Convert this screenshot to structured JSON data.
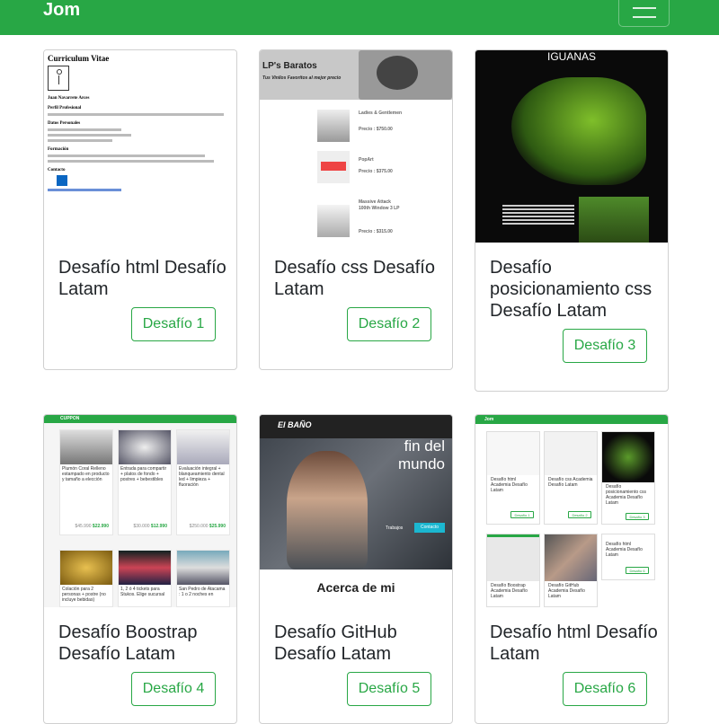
{
  "navbar": {
    "brand": "Jom",
    "brand_color": "#28a745"
  },
  "cards": [
    {
      "title": "Desafío html Desafío Latam",
      "button": "Desafío 1",
      "thumb": {
        "heading": "Curriculum Vitae",
        "name": "Juan Navarrete Arces",
        "sections": [
          "Perfil Profesional",
          "Datos Personales",
          "Formación",
          "Contacto"
        ]
      }
    },
    {
      "title": "Desafío css Desafío Latam",
      "button": "Desafío 2",
      "thumb": {
        "heading": "LP's Baratos",
        "subheading": "Tus Vinilos Favoritos al mejor precio",
        "items": [
          {
            "name": "Ladies & Gentlemen",
            "price": "Precio : $750.00"
          },
          {
            "name": "PopArt",
            "price": "Precio : $375.00"
          },
          {
            "name": "Massive Attack 100th Window 3 LP",
            "price": "Precio : $315.00"
          }
        ]
      }
    },
    {
      "title": "Desafío posicionamiento css Desafío Latam",
      "button": "Desafío 3",
      "thumb": {
        "heading": "IGUANAS"
      }
    },
    {
      "title": "Desafío Boostrap Desafío Latam",
      "button": "Desafío 4",
      "thumb": {
        "brand": "CUPPON",
        "deals": [
          {
            "text": "Plumón Coral Relleno estampado en producto y tamaño a elección",
            "old": "$45.990",
            "price": "$22.990"
          },
          {
            "text": "Entrada para compartir + platos de fondo + postres + bebestibles",
            "old": "$30.000",
            "price": "$12.990"
          },
          {
            "text": "Evaluación integral + blanqueamiento dental led + limpieza + fluoración",
            "old": "$250.000",
            "price": "$25.990"
          },
          {
            "text": "Colación para 2 personas + postre (no incluye bebidas)"
          },
          {
            "text": "1, 2 ó 4 tickets para Stukos. Elige sucursal"
          },
          {
            "text": "San Pedro de Atacama : 1 o 2 noches en"
          }
        ]
      }
    },
    {
      "title": "Desafío GitHub Desafío Latam",
      "button": "Desafío 5",
      "thumb": {
        "logo": "El BAÑO",
        "hero": "fin del mundo",
        "btn1": "Trabajos",
        "btn2": "Contacto",
        "about": "Acerca de mi"
      }
    },
    {
      "title": "Desafío html Desafío Latam",
      "button": "Desafío 6",
      "thumb": {
        "brand": "Jom",
        "cards": [
          {
            "title": "Desafío html Academia Desafío Latam",
            "button": "Desafío 1"
          },
          {
            "title": "Desafío css Academia Desafío Latam",
            "button": "Desafío 2"
          },
          {
            "title": "Desafío posicionamiento css Academia Desafío Latam",
            "button": "Desafío 3"
          },
          {
            "title": "Desafío Boostrap Academia Desafío Latam"
          },
          {
            "title": "Desafío GitHub Academia Desafío Latam"
          },
          {
            "title": "Desafío html Academia Desafío Latam",
            "button": "Desafío 6"
          }
        ]
      }
    }
  ]
}
